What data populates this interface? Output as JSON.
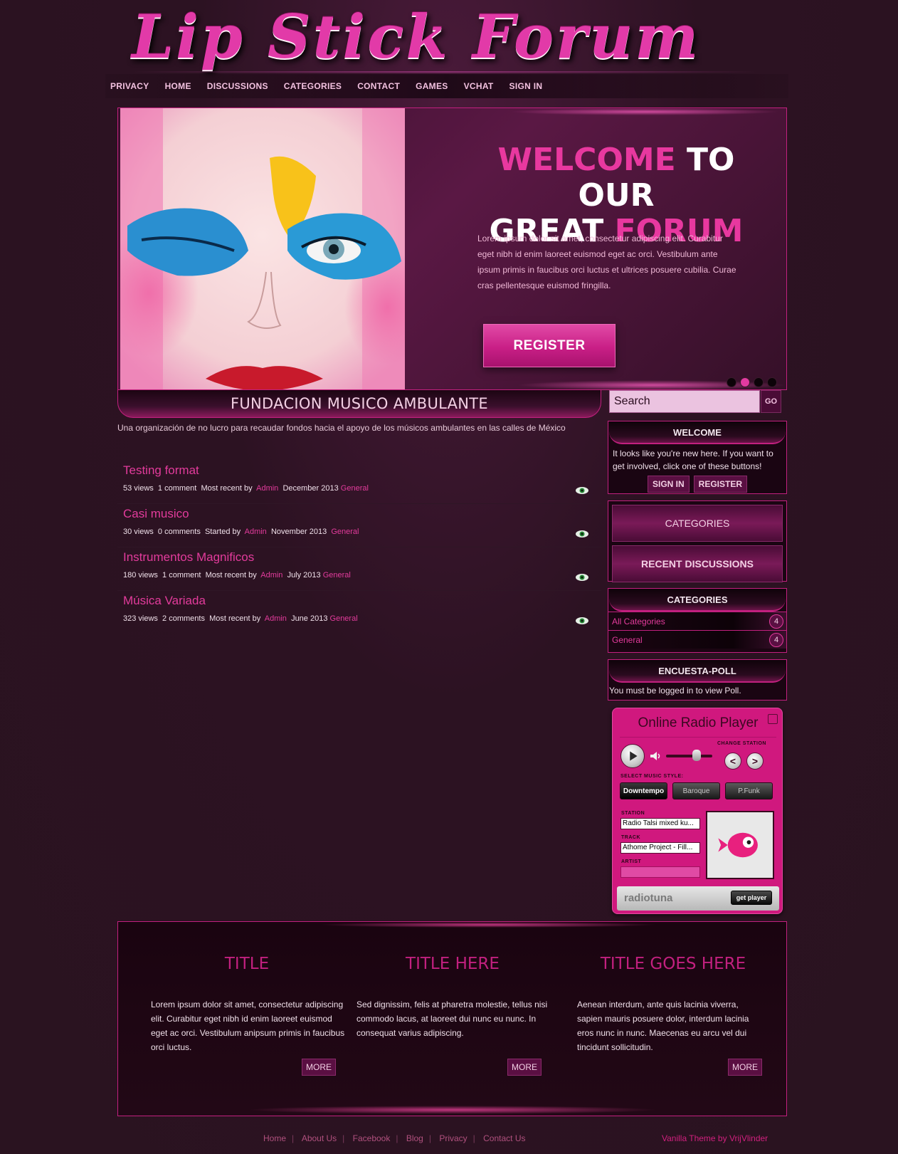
{
  "site": {
    "logo": "Lip Stick Forum"
  },
  "nav": [
    "PRIVACY",
    "HOME",
    "DISCUSSIONS",
    "CATEGORIES",
    "CONTACT",
    "GAMES",
    "VCHAT",
    "SIGN IN"
  ],
  "hero": {
    "welcome_1": "WELCOME",
    "welcome_2": " TO OUR",
    "welcome_3": "GREAT ",
    "welcome_4": "FORUM",
    "text": "Lorem ipsum dolor sit amet, consectetur adipiscing elit. Curabitur eget nibh id enim laoreet euismod eget ac orci. Vestibulum ante ipsum primis in faucibus orci luctus et ultrices posuere cubilia. Curae cras pellentesque euismod fringilla.",
    "register": "REGISTER",
    "active_slide": 2,
    "slide_count": 4
  },
  "section": {
    "title": "FUNDACION MUSICO AMBULANTE",
    "description": "Una organización de no lucro para recaudar fondos hacia el apoyo de los músicos ambulantes en las calles de México"
  },
  "discussions": [
    {
      "title": "Testing format",
      "views": "53 views",
      "comments": "1 comment",
      "recent": "Most recent by",
      "author": "Admin",
      "date": "December 2013",
      "category": "General"
    },
    {
      "title": "Casi musico",
      "views": "30 views",
      "comments": "0 comments",
      "recent": "Started by",
      "author": "Admin",
      "date": "November 2013",
      "category": "General"
    },
    {
      "title": "Instrumentos Magnificos",
      "views": "180 views",
      "comments": "1 comment",
      "recent": "Most recent by",
      "author": "Admin",
      "date": "July 2013",
      "category": "General"
    },
    {
      "title": "Música Variada",
      "views": "323 views",
      "comments": "2 comments",
      "recent": "Most recent by",
      "author": "Admin",
      "date": "June 2013",
      "category": "General"
    }
  ],
  "sidebar": {
    "search_placeholder": "Search",
    "go": "GO",
    "welcome_title": "WELCOME",
    "welcome_text": "It looks like you're new here. If you want to get involved, click one of these buttons!",
    "sign_in": "SIGN IN",
    "register": "REGISTER",
    "categories_btn": "CATEGORIES",
    "recent_btn": "RECENT DISCUSSIONS",
    "categories_title": "CATEGORIES",
    "categories": [
      {
        "label": "All Categories",
        "count": "4"
      },
      {
        "label": "General",
        "count": "4"
      }
    ],
    "poll_title": "ENCUESTA-POLL",
    "poll_text": "You must be logged in to view Poll."
  },
  "radio": {
    "title": "Online Radio Player",
    "change_station": "CHANGE STATION",
    "select_style": "SELECT MUSIC STYLE:",
    "styles": [
      "Downtempo",
      "Baroque",
      "P.Funk"
    ],
    "station_label": "STATION",
    "station": "Radio Talsi mixed ku...",
    "track_label": "TRACK",
    "track": "Athome Project - Fill...",
    "artist_label": "ARTIST",
    "brand": "radiotuna",
    "get_player": "get player"
  },
  "features": [
    {
      "title": "TITLE",
      "text": "Lorem ipsum dolor sit amet, consectetur adipiscing elit. Curabitur eget nibh id enim laoreet euismod eget ac orci. Vestibulum anipsum primis in faucibus orci luctus.",
      "more": "MORE"
    },
    {
      "title": "TITLE HERE",
      "text": "Sed dignissim, felis at pharetra molestie, tellus nisi commodo lacus, at laoreet dui nunc eu nunc. In consequat varius adipiscing.",
      "more": "MORE"
    },
    {
      "title": "TITLE GOES HERE",
      "text": "Aenean interdum, ante quis lacinia viverra, sapien mauris posuere dolor, interdum lacinia eros nunc in nunc. Maecenas eu arcu vel dui tincidunt sollicitudin.",
      "more": "MORE"
    }
  ],
  "footer": {
    "links": [
      "Home",
      "About Us",
      "Facebook",
      "Blog",
      "Privacy",
      "Contact Us"
    ],
    "credit": "Vanilla Theme by VrijVlinder"
  }
}
